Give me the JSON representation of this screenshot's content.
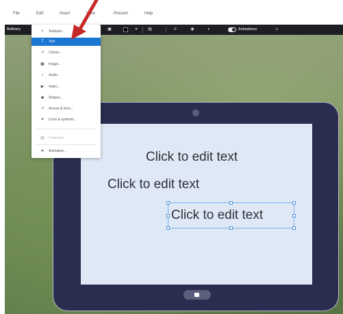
{
  "menubar": {
    "items": [
      "File",
      "Edit",
      "Insert",
      "View",
      "Present",
      "Help"
    ]
  },
  "toolbar": {
    "left_label": "Refinery",
    "animations_label": "Animations"
  },
  "insert_menu": {
    "items": [
      {
        "label": "Subtopic...",
        "icon": "plus-icon"
      },
      {
        "label": "Text",
        "icon": "text-icon"
      },
      {
        "label": "Charts...",
        "icon": "chart-icon"
      },
      {
        "label": "Image...",
        "icon": "image-icon"
      },
      {
        "label": "Audio...",
        "icon": "audio-icon"
      },
      {
        "label": "Video...",
        "icon": "video-icon"
      },
      {
        "label": "Shapes...",
        "icon": "shapes-icon"
      },
      {
        "label": "Arrows & lines...",
        "icon": "arrow-icon"
      },
      {
        "label": "Icons & symbols...",
        "icon": "symbol-icon"
      },
      {
        "label": "Comment",
        "icon": "comment-icon"
      },
      {
        "label": "Animation...",
        "icon": "animation-icon"
      }
    ],
    "highlight_color": "#1976d2"
  },
  "slide": {
    "text_1": "Click to edit text",
    "text_2": "Click to edit text",
    "text_3": "Click to edit text"
  },
  "colors": {
    "tablet_frame": "#2b2d50",
    "screen": "#dfe9f5",
    "annotation_arrow": "#c62828"
  }
}
